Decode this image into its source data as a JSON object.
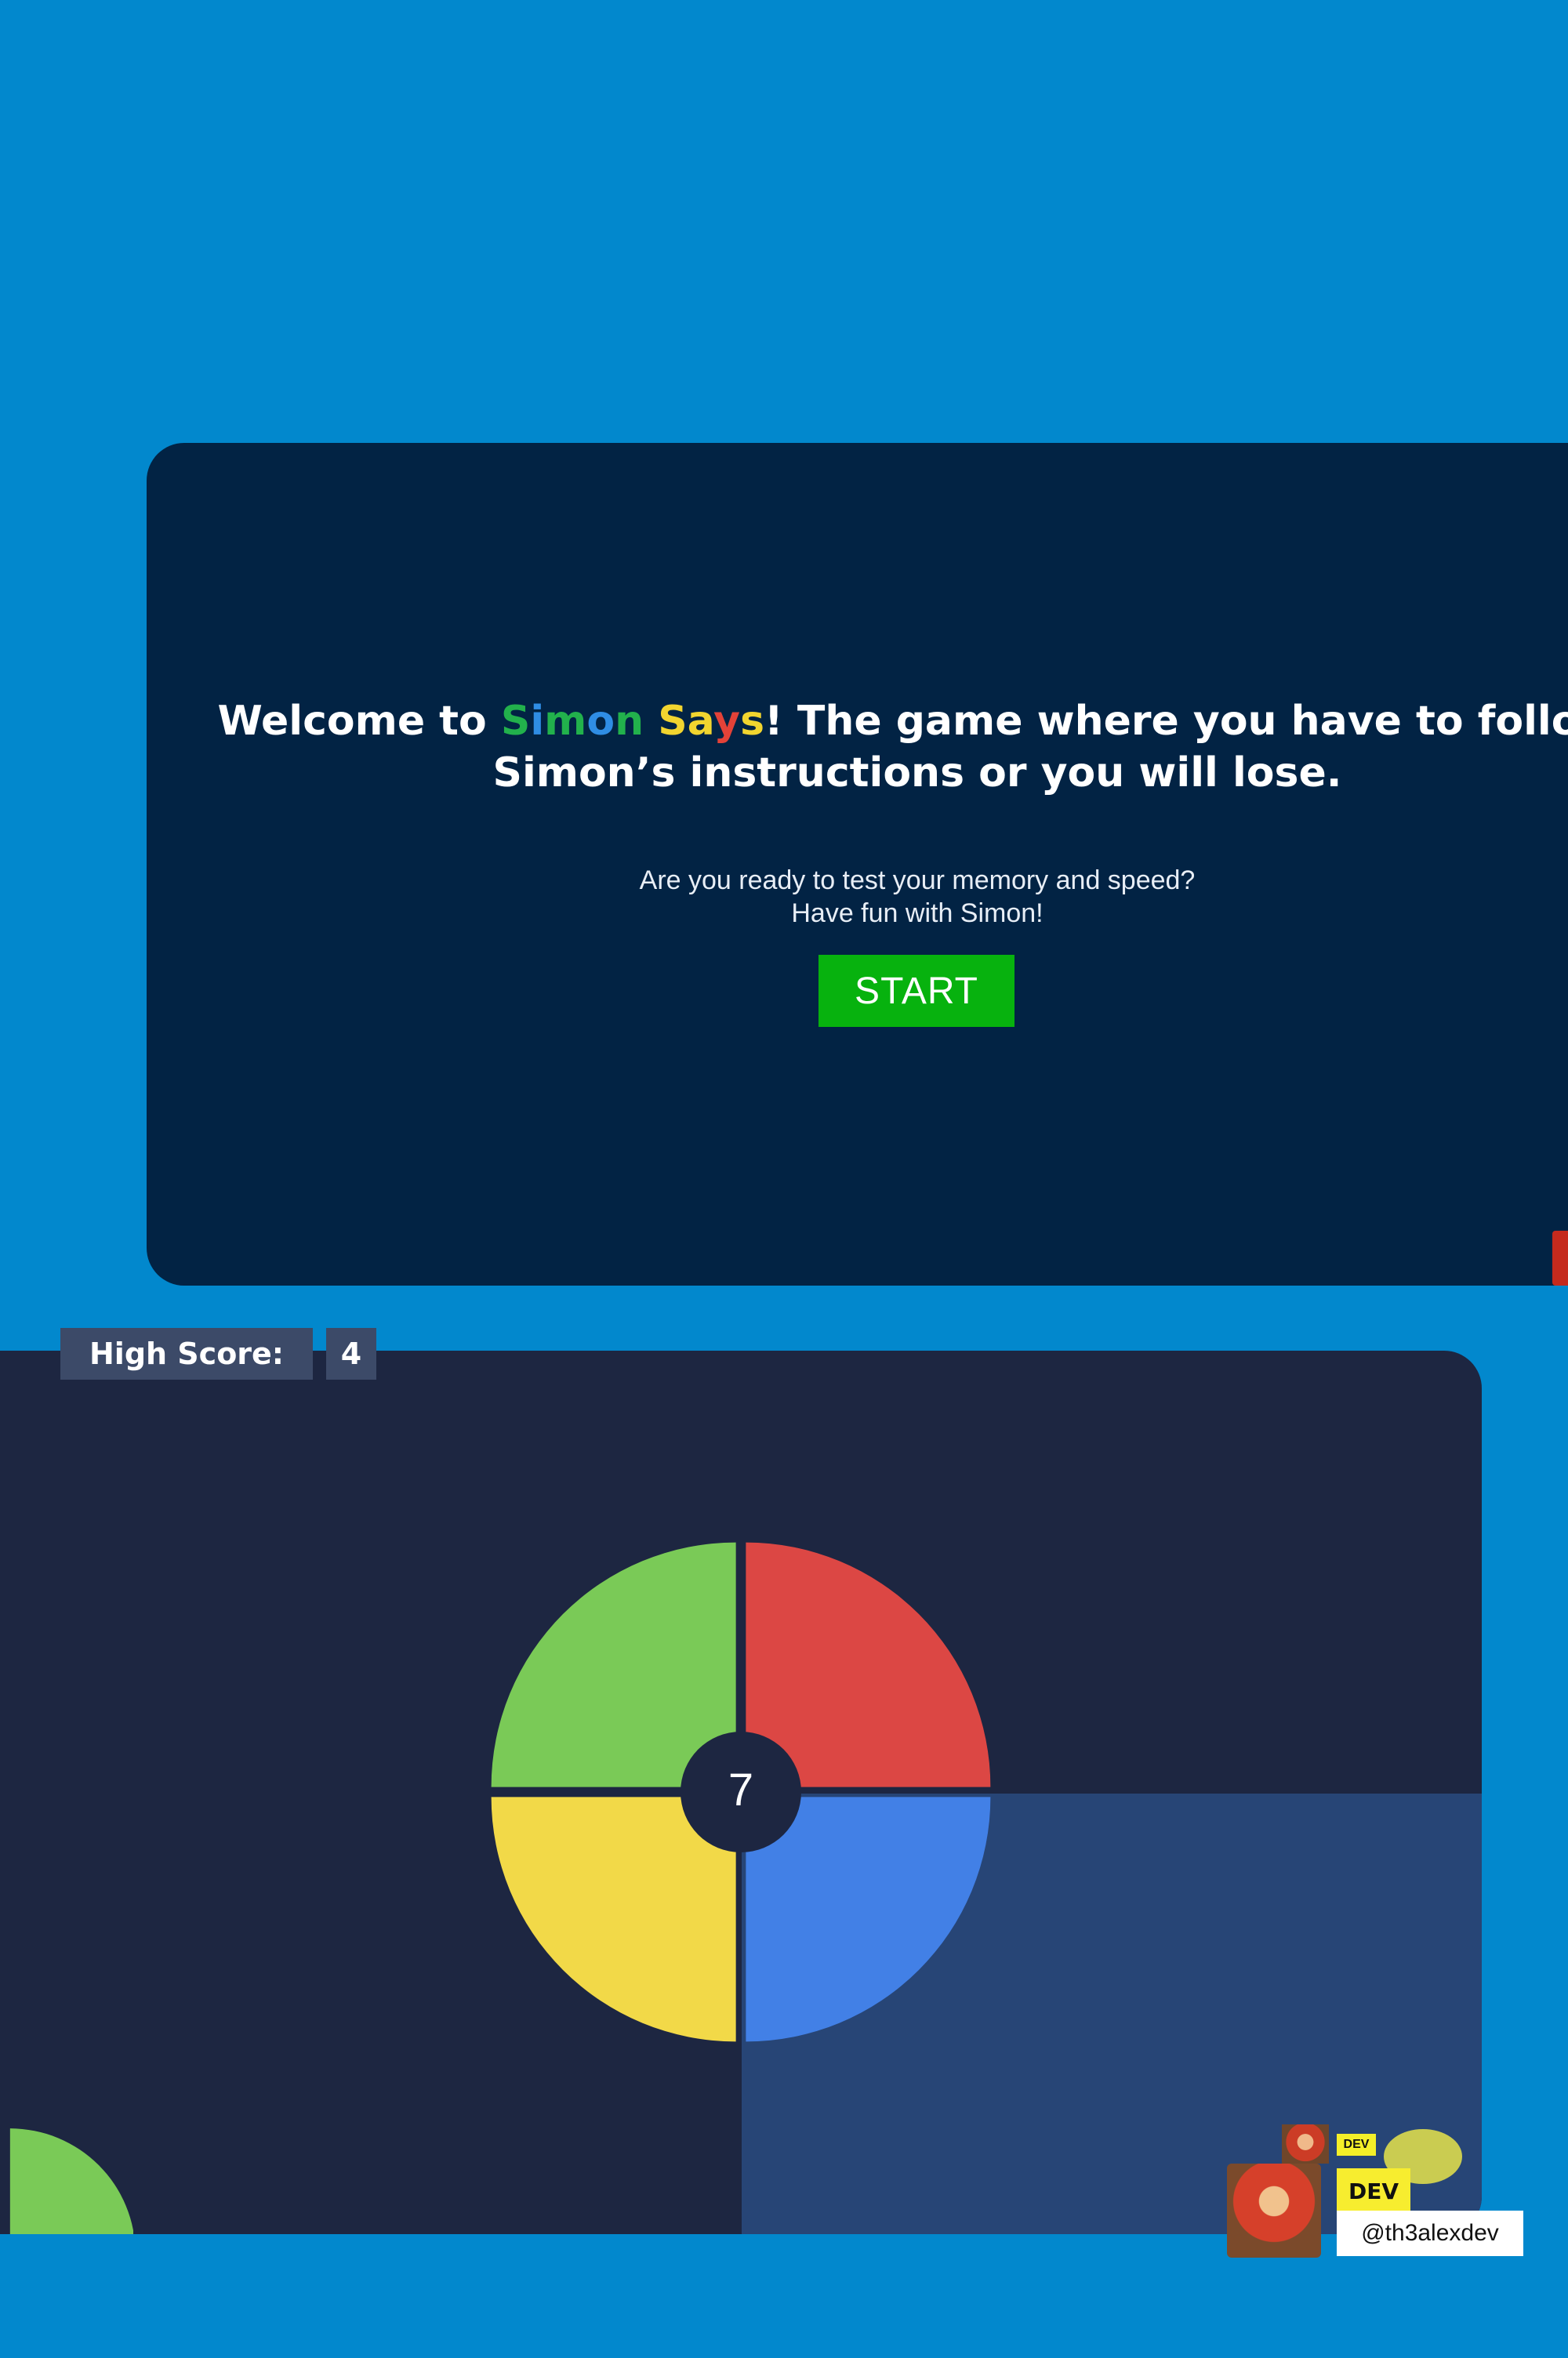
{
  "welcome": {
    "title_prefix": "Welcome to ",
    "title_brand_letters": [
      {
        "ch": "S",
        "color": "#22b14c"
      },
      {
        "ch": "i",
        "color": "#2f8de4"
      },
      {
        "ch": "m",
        "color": "#22b14c"
      },
      {
        "ch": "o",
        "color": "#2f8de4"
      },
      {
        "ch": "n",
        "color": "#22b14c"
      },
      {
        "ch": " ",
        "color": "#ffffff"
      },
      {
        "ch": "S",
        "color": "#f2d52f"
      },
      {
        "ch": "a",
        "color": "#f2d52f"
      },
      {
        "ch": "y",
        "color": "#e34238"
      },
      {
        "ch": "s",
        "color": "#f2d52f"
      }
    ],
    "title_suffix": "! The game where you have to follow",
    "title_line2": "Simon’s instructions or you will lose.",
    "subtext_line1": "Are you ready to test your memory and speed?",
    "subtext_line2": "Have fun with Simon!",
    "start_label": "START"
  },
  "game": {
    "high_score_label": "High Score:",
    "high_score_value": "4",
    "center_number": "7",
    "colors": {
      "green": "#7aca57",
      "red": "#dc4744",
      "yellow": "#f2d948",
      "blue": "#4280e6",
      "hub": "#1d2641"
    }
  },
  "badge": {
    "dev_small": "DEV",
    "dev_label": "DEV",
    "handle": "@th3alexdev"
  }
}
